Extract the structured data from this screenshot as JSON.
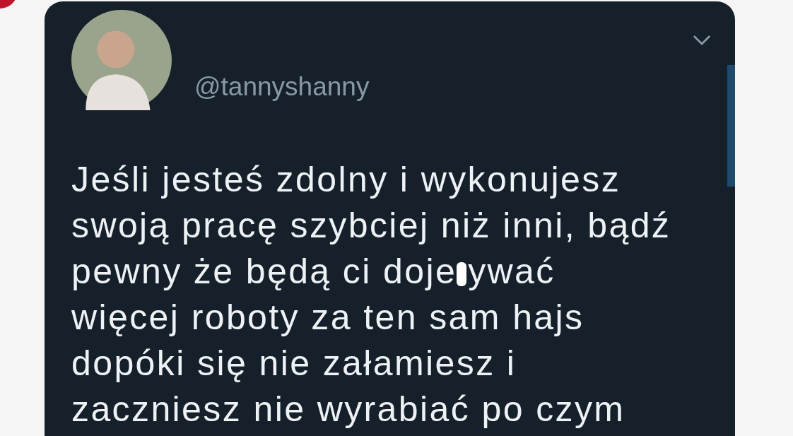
{
  "tweet": {
    "handle": "@tannyshanny",
    "lines": [
      {
        "parts": [
          "Jeśli jesteś zdolny i wykonujesz"
        ]
      },
      {
        "parts": [
          "swoją pracę szybciej niż inni, bądź"
        ]
      },
      {
        "parts": [
          "pewny że będą ci doje",
          "ywać"
        ]
      },
      {
        "parts": [
          "więcej roboty za ten sam hajs"
        ]
      },
      {
        "parts": [
          "dopóki się nie załamiesz i"
        ]
      },
      {
        "parts": [
          "zaczniesz nie wyrabiać po czym"
        ]
      }
    ]
  }
}
